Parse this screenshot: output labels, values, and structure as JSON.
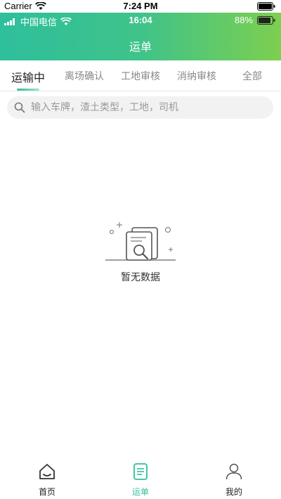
{
  "simulator_bar": {
    "carrier": "Carrier",
    "time": "7:24 PM"
  },
  "device_status": {
    "carrier": "中国电信",
    "time": "16:04",
    "battery": "88%"
  },
  "header": {
    "title": "运单"
  },
  "tabs": [
    {
      "label": "运输中",
      "active": true
    },
    {
      "label": "离场确认",
      "active": false
    },
    {
      "label": "工地审核",
      "active": false
    },
    {
      "label": "消纳审核",
      "active": false
    },
    {
      "label": "全部",
      "active": false
    }
  ],
  "search": {
    "placeholder": "输入车牌，渣土类型，工地，司机",
    "value": ""
  },
  "empty_state": {
    "icon": "empty-document-search-icon",
    "text": "暂无数据"
  },
  "bottom_nav": [
    {
      "label": "首页",
      "icon": "home-icon",
      "active": false
    },
    {
      "label": "运单",
      "icon": "waybill-icon",
      "active": true
    },
    {
      "label": "我的",
      "icon": "profile-icon",
      "active": false
    }
  ],
  "colors": {
    "accent": "#2ebf9c",
    "header_end": "#7dcf4f"
  }
}
